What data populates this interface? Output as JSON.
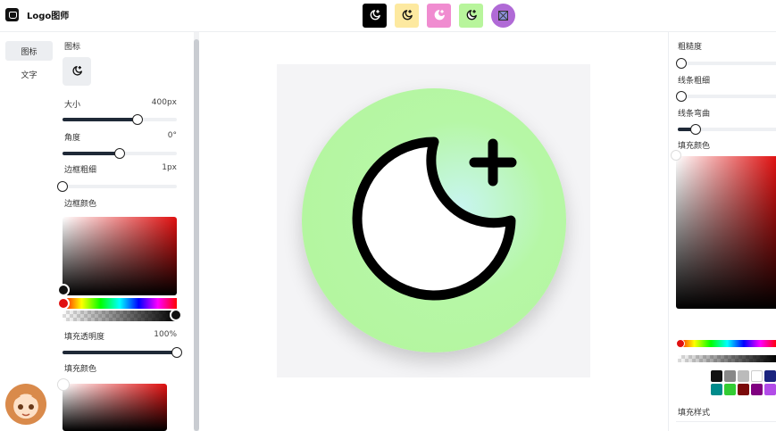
{
  "app": {
    "title": "Logo图师"
  },
  "presets": [
    {
      "name": "preset-black",
      "bg": "#000000",
      "fg": "#ffffff"
    },
    {
      "name": "preset-yellow",
      "bg": "#fde9a0",
      "fg": "#111111"
    },
    {
      "name": "preset-pink",
      "bg": "#f08cd0",
      "fg": "#ffffff"
    },
    {
      "name": "preset-green",
      "bg": "#b8f59c",
      "fg": "#111111"
    },
    {
      "name": "preset-purple",
      "bg": "#b06ad6",
      "fg": "#222222"
    }
  ],
  "tabs": {
    "icon": "图标",
    "text": "文字"
  },
  "left": {
    "icon_label": "图标",
    "size_label": "大小",
    "size_value": "400px",
    "size_level": 0.66,
    "angle_label": "角度",
    "angle_value": "0°",
    "angle_level": 0.5,
    "border_width_label": "边框粗细",
    "border_width_value": "1px",
    "border_width_level": 0.0,
    "border_color_label": "边框颜色",
    "fill_opacity_label": "填充透明度",
    "fill_opacity_value": "100%",
    "fill_opacity_level": 1.0,
    "fill_color_label": "填充颜色"
  },
  "right": {
    "roughness_label": "粗糙度",
    "stroke_width_label": "线条粗细",
    "stroke_curve_label": "线条弯曲",
    "fill_color_label": "填充颜色",
    "fill_style_label": "填充样式",
    "swatches": [
      "#111111",
      "#888888",
      "#bbbbbb",
      "#ffffff",
      "#1a237e",
      "#008b8b",
      "#33cc33",
      "#7b0a0a",
      "#800080",
      "#b24ce8"
    ]
  },
  "canvas": {
    "icon": "moon-plus-icon",
    "circle_color": "#b3f59b"
  }
}
